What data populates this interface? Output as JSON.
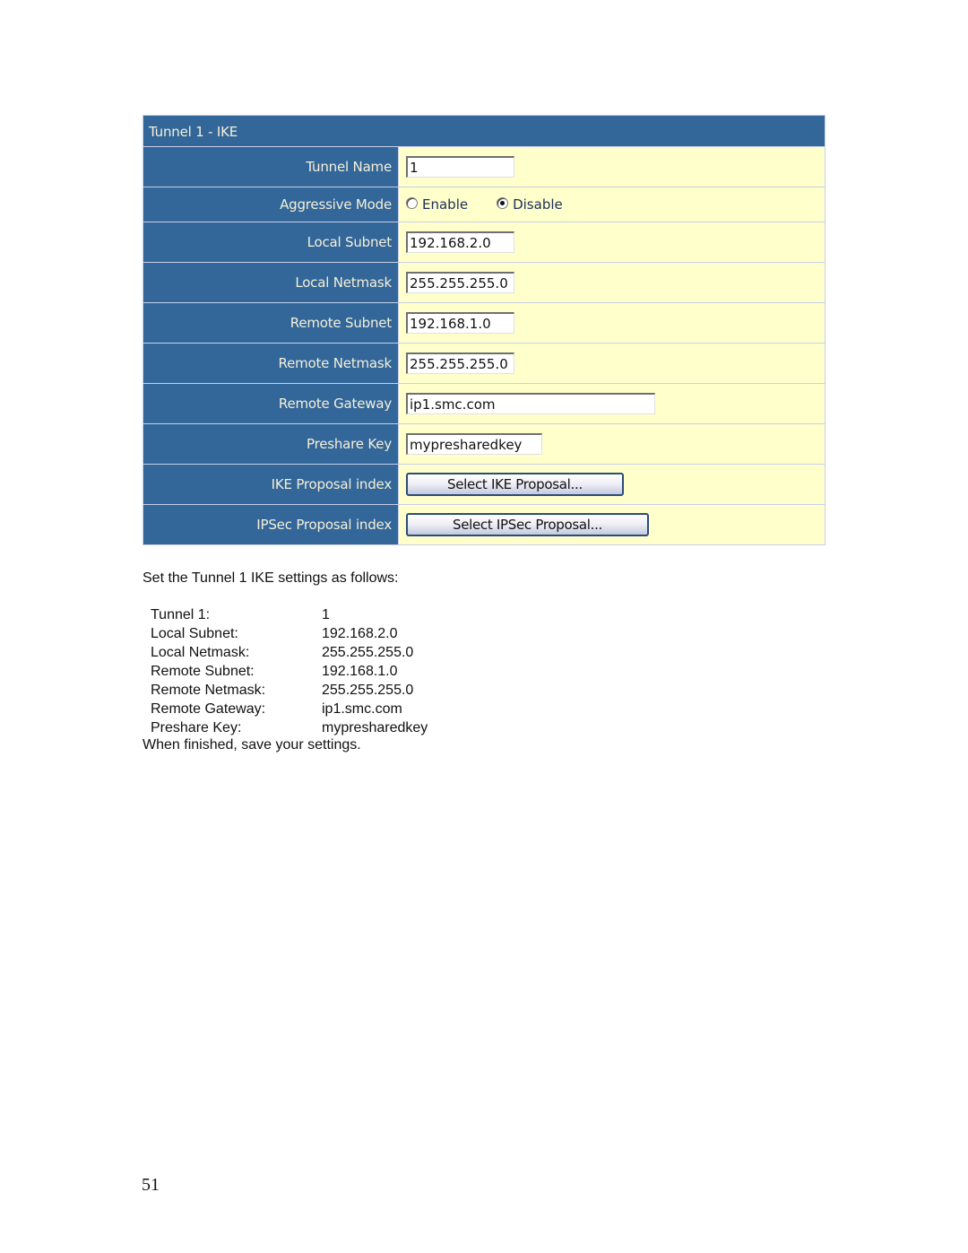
{
  "form": {
    "title": "Tunnel 1 - IKE",
    "fields": {
      "tunnel_name": {
        "label": "Tunnel Name",
        "value": "1"
      },
      "aggressive_mode": {
        "label": "Aggressive Mode",
        "options": [
          "Enable",
          "Disable"
        ],
        "selected": "Disable"
      },
      "local_subnet": {
        "label": "Local Subnet",
        "value": "192.168.2.0"
      },
      "local_netmask": {
        "label": "Local Netmask",
        "value": "255.255.255.0"
      },
      "remote_subnet": {
        "label": "Remote Subnet",
        "value": "192.168.1.0"
      },
      "remote_netmask": {
        "label": "Remote Netmask",
        "value": "255.255.255.0"
      },
      "remote_gateway": {
        "label": "Remote Gateway",
        "value": "ip1.smc.com"
      },
      "preshare_key": {
        "label": "Preshare Key",
        "value": "mypresharedkey"
      },
      "ike_proposal": {
        "label": "IKE Proposal index",
        "button": "Select IKE Proposal..."
      },
      "ipsec_proposal": {
        "label": "IPSec Proposal index",
        "button": "Select IPSec Proposal..."
      }
    },
    "colors": {
      "label_bg": "#336699",
      "value_bg": "#ffffcc",
      "label_text": "#f4f0d8"
    }
  },
  "doc": {
    "intro": "Set the Tunnel 1 IKE settings as follows:",
    "settings": [
      {
        "key": "Tunnel 1:",
        "value": "1"
      },
      {
        "key": "Local Subnet:",
        "value": "192.168.2.0"
      },
      {
        "key": "Local Netmask:",
        "value": "255.255.255.0"
      },
      {
        "key": "Remote Subnet:",
        "value": "192.168.1.0"
      },
      {
        "key": "Remote Netmask:",
        "value": "255.255.255.0"
      },
      {
        "key": "Remote Gateway:",
        "value": "ip1.smc.com"
      },
      {
        "key": "Preshare Key:",
        "value": "mypresharedkey"
      }
    ],
    "closing": "When finished, save your settings.",
    "page_number": "51"
  }
}
